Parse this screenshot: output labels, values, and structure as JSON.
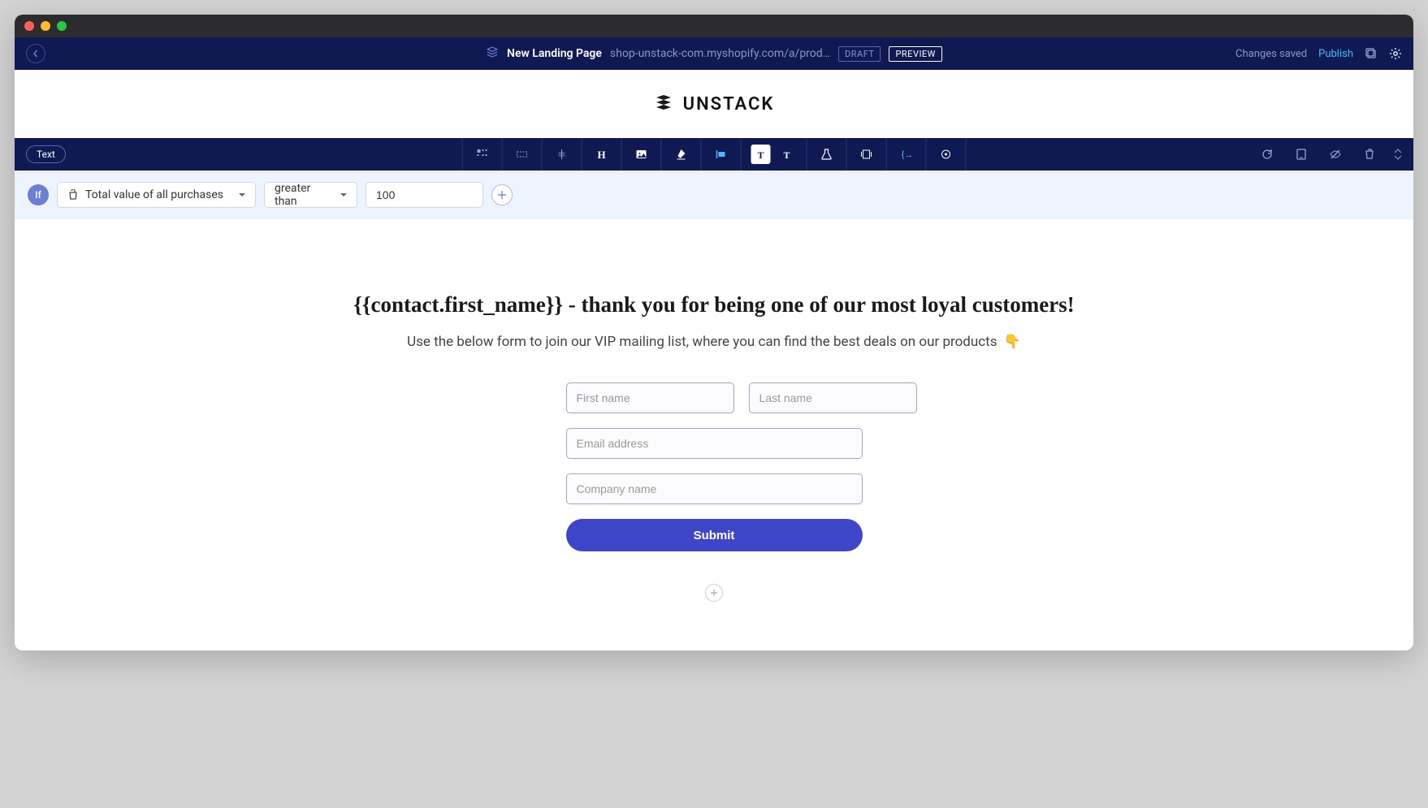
{
  "topbar": {
    "page_title": "New Landing Page",
    "page_url": "shop-unstack-com.myshopify.com/a/prod…",
    "draft_badge": "DRAFT",
    "preview_badge": "PREVIEW",
    "saved_text": "Changes saved",
    "publish_label": "Publish"
  },
  "brand": {
    "name": "UNSTACK"
  },
  "toolbar": {
    "text_pill": "Text"
  },
  "condition": {
    "if_label": "If",
    "field_select": "Total value of all purchases",
    "operator_select": "greater than",
    "value_input": "100"
  },
  "content": {
    "headline": "{{contact.first_name}} - thank you for being one of our most loyal customers!",
    "subhead": "Use the below form to join our VIP mailing list, where you can find the best deals on our products",
    "emoji": "👇"
  },
  "form": {
    "first_name_placeholder": "First name",
    "last_name_placeholder": "Last name",
    "email_placeholder": "Email address",
    "company_placeholder": "Company name",
    "submit_label": "Submit"
  }
}
